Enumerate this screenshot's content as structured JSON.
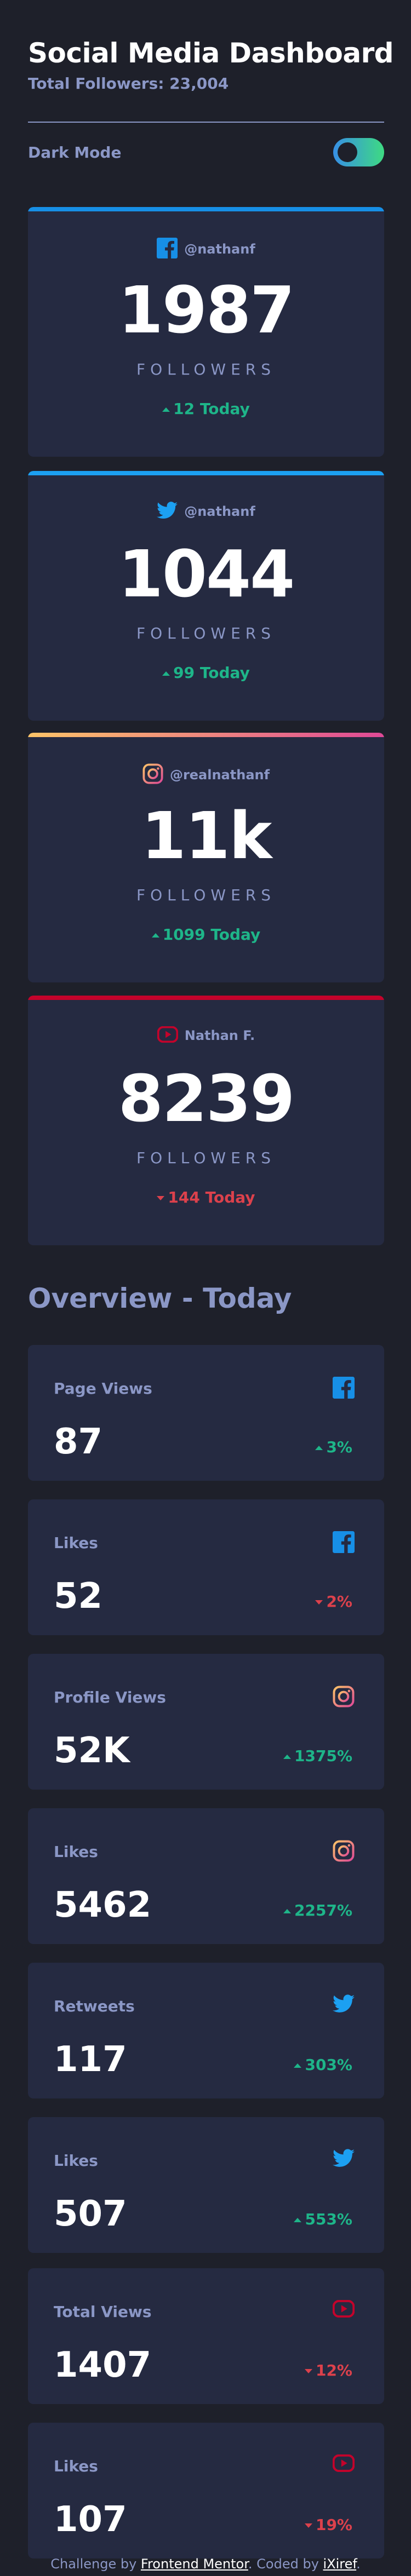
{
  "header": {
    "title": "Social Media Dashboard",
    "total_followers": "Total Followers: 23,004",
    "dark_mode_label": "Dark Mode",
    "dark_mode_on": true
  },
  "colors": {
    "facebook": "#178fe6",
    "twitter": "#1ca0f2",
    "instagram_gradient": [
      "#fdc468",
      "#df4996"
    ],
    "youtube": "#c4032b",
    "up": "#1eb589",
    "down": "#dc414c",
    "toggle_gradient": [
      "#378fe6",
      "#3eda82"
    ]
  },
  "cards": [
    {
      "platform": "facebook",
      "icon": "facebook-icon",
      "handle": "@nathanf",
      "count": "1987",
      "label": "FOLLOWERS",
      "today": "12 Today",
      "trend": "up"
    },
    {
      "platform": "twitter",
      "icon": "twitter-icon",
      "handle": "@nathanf",
      "count": "1044",
      "label": "FOLLOWERS",
      "today": "99 Today",
      "trend": "up"
    },
    {
      "platform": "instagram",
      "icon": "instagram-icon",
      "handle": "@realnathanf",
      "count": "11k",
      "label": "FOLLOWERS",
      "today": "1099 Today",
      "trend": "up"
    },
    {
      "platform": "youtube",
      "icon": "youtube-icon",
      "handle": "Nathan F.",
      "count": "8239",
      "label": "FOLLOWERS",
      "today": "144 Today",
      "trend": "down"
    }
  ],
  "overview": {
    "title": "Overview - Today",
    "items": [
      {
        "name": "Page Views",
        "platform": "facebook",
        "icon": "facebook-icon",
        "value": "87",
        "change": "3%",
        "trend": "up"
      },
      {
        "name": "Likes",
        "platform": "facebook",
        "icon": "facebook-icon",
        "value": "52",
        "change": "2%",
        "trend": "down"
      },
      {
        "name": "Profile Views",
        "platform": "instagram",
        "icon": "instagram-icon",
        "value": "52K",
        "change": "1375%",
        "trend": "up"
      },
      {
        "name": "Likes",
        "platform": "instagram",
        "icon": "instagram-icon",
        "value": "5462",
        "change": "2257%",
        "trend": "up"
      },
      {
        "name": "Retweets",
        "platform": "twitter",
        "icon": "twitter-icon",
        "value": "117",
        "change": "303%",
        "trend": "up"
      },
      {
        "name": "Likes",
        "platform": "twitter",
        "icon": "twitter-icon",
        "value": "507",
        "change": "553%",
        "trend": "up"
      },
      {
        "name": "Total Views",
        "platform": "youtube",
        "icon": "youtube-icon",
        "value": "1407",
        "change": "12%",
        "trend": "down"
      },
      {
        "name": "Likes",
        "platform": "youtube",
        "icon": "youtube-icon",
        "value": "107",
        "change": "19%",
        "trend": "down"
      }
    ]
  },
  "footer": {
    "prefix": "Challenge by ",
    "link1": "Frontend Mentor",
    "middle": ". Coded by ",
    "link2": "iXiref",
    "suffix": "."
  }
}
